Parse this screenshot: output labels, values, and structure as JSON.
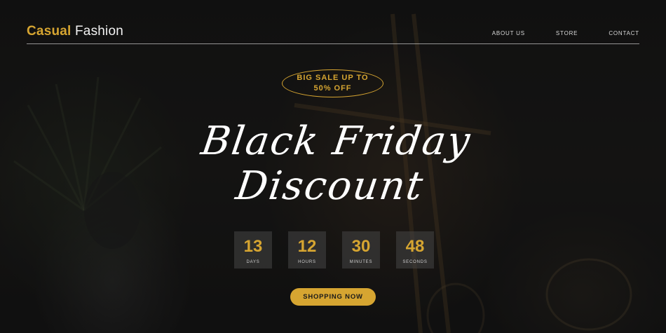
{
  "brand": {
    "accent_word": "Casual",
    "rest_word": "Fashion"
  },
  "nav": {
    "items": [
      {
        "label": "ABOUT US"
      },
      {
        "label": "STORE"
      },
      {
        "label": "CONTACT"
      }
    ]
  },
  "badge": {
    "line1": "BIG SALE UP TO",
    "line2": "50% OFF"
  },
  "headline": {
    "line1": "Black Friday",
    "line2": "Discount"
  },
  "countdown": [
    {
      "value": "13",
      "label": "DAYS"
    },
    {
      "value": "12",
      "label": "HOURS"
    },
    {
      "value": "30",
      "label": "MINUTES"
    },
    {
      "value": "48",
      "label": "SECONDS"
    }
  ],
  "cta": {
    "label": "SHOPPING NOW"
  },
  "colors": {
    "accent": "#d6a531",
    "background": "#121212",
    "text": "#ffffff"
  }
}
